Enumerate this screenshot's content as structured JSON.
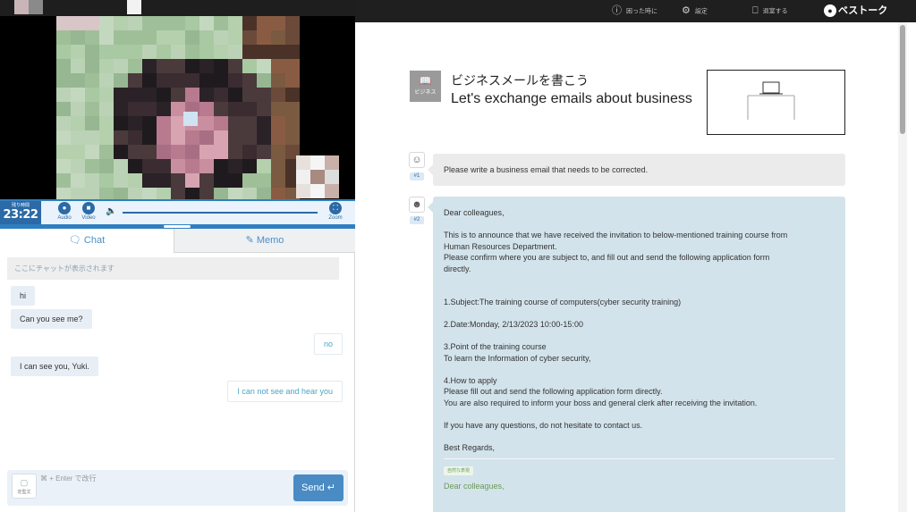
{
  "video_panel": {
    "timer_label": "残り時間",
    "timer_value": "23:22",
    "audio_label": "Audio",
    "video_label": "Video",
    "zoom_label": "Zoom",
    "volume_level": 1.0
  },
  "tabs": [
    {
      "label": "Chat",
      "icon": "chat-icon",
      "active": true
    },
    {
      "label": "Memo",
      "icon": "edit-icon",
      "active": false
    }
  ],
  "chat": {
    "system_message": "ここにチャットが表示されます",
    "messages": [
      {
        "side": "in",
        "text": "hi"
      },
      {
        "side": "in",
        "text": "Can you see me?"
      },
      {
        "side": "out",
        "text": "no"
      },
      {
        "side": "in",
        "text": "I can see you, Yuki."
      },
      {
        "side": "out",
        "text": "I can not see and hear you"
      }
    ],
    "template_label": "定型文",
    "input_placeholder": "⌘ + Enter で改行",
    "send_label": "Send"
  },
  "topbar": {
    "help_label": "困った時に",
    "settings_label": "設定",
    "exit_label": "退室する",
    "logo_text": "ベストーク"
  },
  "lesson": {
    "category": "ビジネス",
    "title_jp": "ビジネスメールを書こう",
    "title_en": "Let's exchange emails about business",
    "prompt_number": "#1",
    "prompt": "Please write a business email that needs to be corrected.",
    "email_number": "#2",
    "email_lines": [
      "Dear colleagues,",
      "",
      "This is to announce that we have received the invitation to below-mentioned training course from",
      "Human Resources Department.",
      "Please confirm where you are subject to, and  fill out and send the following application form",
      "directly.",
      "",
      "",
      "1.Subject:The training course of computers(cyber security training)",
      "",
      "2.Date:Monday, 2/13/2023 10:00-15:00",
      "",
      "3.Point of the training course",
      "To learn the Information of cyber security,",
      "",
      "4.How to apply",
      "Please fill out and send the following application form directly.",
      "You are also required to inform your boss and general clerk after receiving the invitation.",
      "",
      "If you have any questions, do not hesitate to contact us.",
      "",
      "Best Regards,"
    ],
    "feedback_tag": "自然な表現",
    "feedback_text": "Dear colleagues,"
  },
  "colors": {
    "accent": "#2b6aa6",
    "email_bg": "#d3e3eb",
    "topbar_bg": "#1f1f1f",
    "feedback_green": "#6a9b57"
  }
}
